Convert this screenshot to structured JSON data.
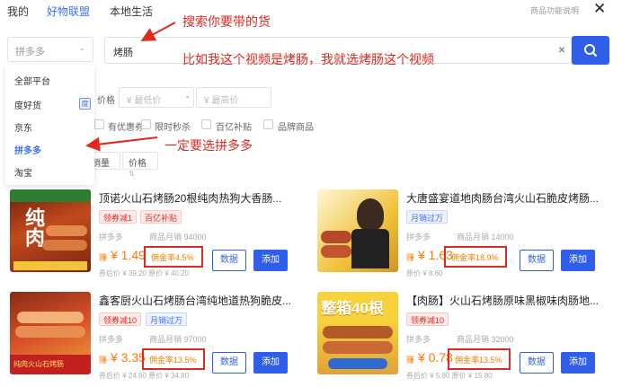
{
  "tabs": [
    "我的",
    "好物联盟",
    "本地生活"
  ],
  "active_tab": 1,
  "help_link": "商品功能说明",
  "platform_select": {
    "placeholder": "拼多多"
  },
  "search": {
    "value": "烤肠"
  },
  "dropdown": {
    "items": [
      "全部平台",
      "度好货",
      "京东",
      "拼多多",
      "淘宝"
    ],
    "active_index": 3,
    "badge": "度"
  },
  "filters": {
    "price_label": "价格",
    "min_placeholder": "¥ 最低价",
    "max_placeholder": "¥ 最高价",
    "dash": "-",
    "checkboxes": [
      "有优惠券",
      "限时秒杀",
      "百亿补贴",
      "品牌商品"
    ],
    "sort": [
      "销量",
      "价格"
    ]
  },
  "annotations": {
    "a1": "搜索你要带的货",
    "a2": "比如我这个视频是烤肠，我就选烤肠这个视频",
    "a3": "一定要选拼多多"
  },
  "products": [
    {
      "title": "顶诺火山石烤肠20根纯肉热狗大香肠...",
      "tags": [
        "领券减1",
        "百亿补贴"
      ],
      "platform": "拼多多",
      "sales": "商品月销 94000",
      "earn_label": "赚",
      "price": "¥ 1.49",
      "commission": "佣金率4.5%",
      "original": "券后价 ¥ 39.20  原价 ¥ 40.20",
      "btn_data": "数据",
      "btn_add": "添加",
      "thumb_text": "纯肉"
    },
    {
      "title": "大唐盛宴道地肉肠台湾火山石脆皮烤肠...",
      "tags": [
        "月销过万"
      ],
      "platform": "拼多多",
      "sales": "商品月销 14000",
      "earn_label": "赚",
      "price": "¥ 1.63",
      "commission": "佣金率18.9%",
      "original": "原价 ¥ 8.60",
      "btn_data": "数据",
      "btn_add": "添加",
      "thumb_text": ""
    },
    {
      "title": "鑫客厨火山石烤肠台湾纯地道热狗脆皮...",
      "tags": [
        "领券减10",
        "月销过万"
      ],
      "platform": "拼多多",
      "sales": "商品月销 97000",
      "earn_label": "赚",
      "price": "¥ 3.35",
      "commission": "佣金率13.5%",
      "original": "券后价 ¥ 24.80  原价 ¥ 34.80",
      "btn_data": "数据",
      "btn_add": "添加",
      "thumb_text": "纯肉火山石烤肠"
    },
    {
      "title": "【肉肠】火山石烤肠原味黑椒味肉肠地...",
      "tags": [
        "领券减10"
      ],
      "platform": "拼多多",
      "sales": "商品月销 32000",
      "earn_label": "赚",
      "price": "¥ 0.78",
      "commission": "佣金率13.5%",
      "original": "券后价 ¥ 5.80  原价 ¥ 15.80",
      "btn_data": "数据",
      "btn_add": "添加",
      "thumb_text": "整箱40根"
    }
  ],
  "colors": {
    "accent": "#2f5fe8",
    "annotation": "#e2281f",
    "price": "#ff7a00"
  }
}
